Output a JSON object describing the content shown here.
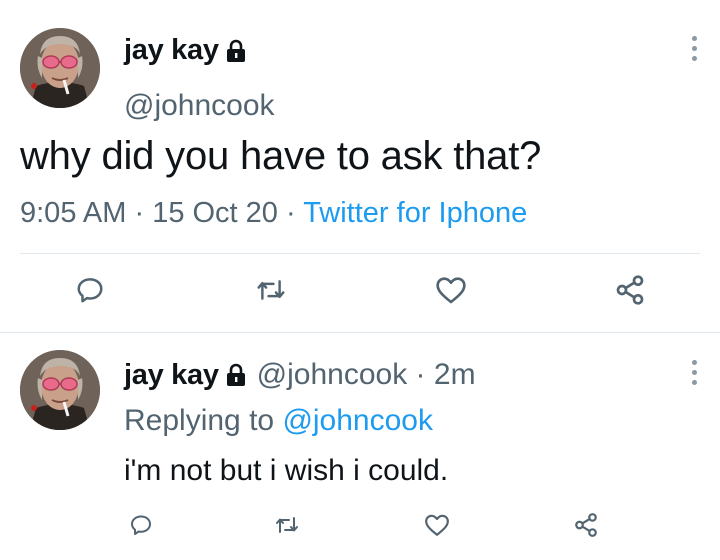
{
  "main_tweet": {
    "display_name": "jay kay",
    "handle": "@johncook",
    "text": "why did you have to ask that?",
    "time": "9:05 AM",
    "date": "15 Oct 20",
    "separator": " · ",
    "source": "Twitter for Iphone",
    "protected": true
  },
  "reply_tweet": {
    "display_name": "jay kay",
    "handle": "@johncook",
    "age": "2m",
    "separator": " · ",
    "replying_prefix": "Replying to ",
    "replying_mention": "@johncook",
    "text": "i'm not but i wish i could.",
    "protected": true
  },
  "actions": [
    {
      "name": "reply",
      "icon": "reply-icon"
    },
    {
      "name": "retweet",
      "icon": "retweet-icon"
    },
    {
      "name": "like",
      "icon": "heart-icon"
    },
    {
      "name": "share",
      "icon": "share-icon"
    }
  ],
  "colors": {
    "text": "#0f1419",
    "secondary": "#536471",
    "link": "#1d9bf0",
    "divider": "#e1e8ed"
  }
}
